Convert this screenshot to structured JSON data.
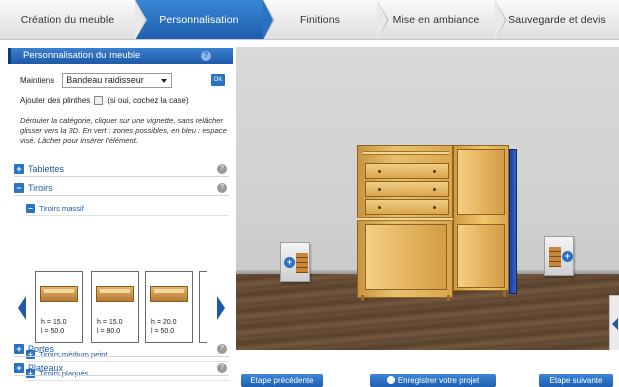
{
  "steps": [
    {
      "label": "Création du meuble",
      "active": false
    },
    {
      "label": "Personnalisation",
      "active": true
    },
    {
      "label": "Finitions",
      "active": false
    },
    {
      "label": "Mise en ambiance",
      "active": false
    },
    {
      "label": "Sauvegarde et devis",
      "active": false
    }
  ],
  "panel": {
    "title": "Personnalisation du meuble",
    "help_icon": "?",
    "maintiens_label": "Maintiens",
    "maintiens_value": "Bandeau raidisseur",
    "ok_label": "OK",
    "plinthes_label": "Ajouter des plinthes",
    "plinthes_hint": "(si oui, cochez la case)",
    "instructions": "Dérouler la catégorie, cliquer sur une vignette, sans relâcher glisser vers la 3D. En vert : zones possibles, en bleu : espace visé. Lâcher pour insérer l'élément."
  },
  "accordion": {
    "tablettes": {
      "label": "Tablettes",
      "state": "+"
    },
    "tiroirs": {
      "label": "Tiroirs",
      "state": "−"
    },
    "tiroirs_massif": {
      "label": "Tiroirs massif",
      "state": "−"
    },
    "tiroirs_medium": {
      "label": "Tiroirs médium peint",
      "state": "+"
    },
    "tiroirs_plaques": {
      "label": "Tiroirs plaqués",
      "state": "+"
    },
    "portes": {
      "label": "Portes",
      "state": "+"
    },
    "plateaux": {
      "label": "Plateaux",
      "state": "+"
    },
    "help_glyph": "?"
  },
  "thumbnails": [
    {
      "h": "h = 15.0",
      "l": "l = 50.0"
    },
    {
      "h": "h = 15.0",
      "l": "l = 80.0"
    },
    {
      "h": "h = 20.0",
      "l": "l = 50.0"
    }
  ],
  "buttons": {
    "prev": "Etape précédente",
    "save": "Enregistrer votre projet",
    "next": "Etape suivante"
  },
  "colors": {
    "accent": "#1e5aa8",
    "active_step": "#2a72c2",
    "wood": "#e1b05b",
    "side_panel": "#1c3f9a"
  }
}
